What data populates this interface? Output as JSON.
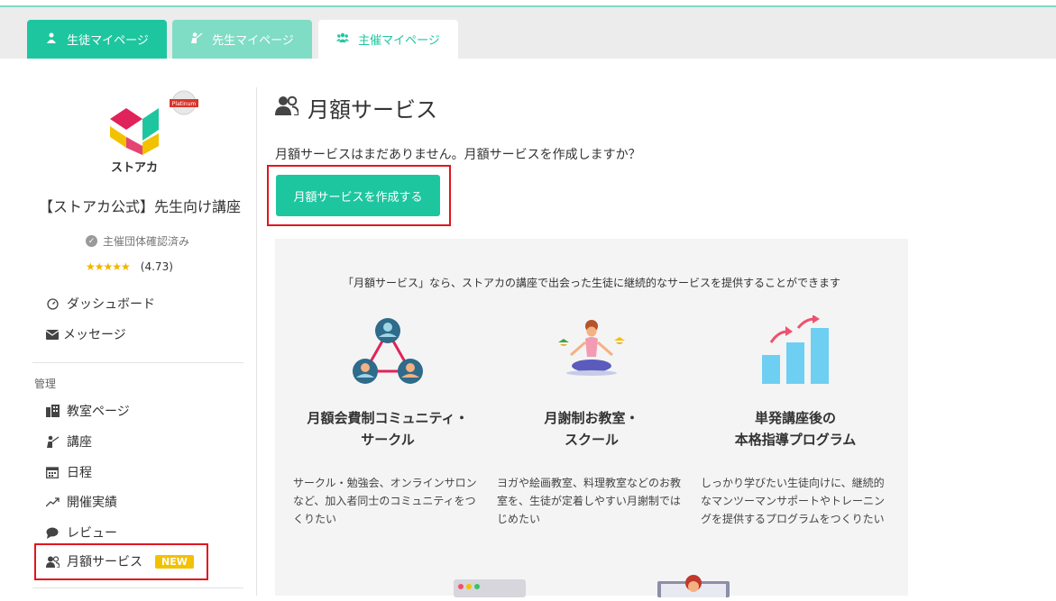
{
  "tabs": [
    {
      "label": "生徒マイページ"
    },
    {
      "label": "先生マイページ"
    },
    {
      "label": "主催マイページ"
    }
  ],
  "sidebar": {
    "logo_text": "ストアカ",
    "badge_text": "Platinum",
    "school_name": "【ストアカ公式】先生向け講座",
    "verified": "主催団体確認済み",
    "stars": "★★★★★",
    "rating": "(4.73)",
    "top_items": [
      {
        "label": "ダッシュボード"
      },
      {
        "label": "メッセージ"
      }
    ],
    "section_title": "管理",
    "manage_items": [
      {
        "label": "教室ページ"
      },
      {
        "label": "講座"
      },
      {
        "label": "日程"
      },
      {
        "label": "開催実績"
      },
      {
        "label": "レビュー"
      },
      {
        "label": "月額サービス",
        "badge": "NEW"
      }
    ]
  },
  "main": {
    "title": "月額サービス",
    "empty_message": "月額サービスはまだありません。月額サービスを作成しますか？",
    "create_button": "月額サービスを作成する",
    "info": {
      "lead": "「月額サービス」なら、ストアカの講座で出会った生徒に継続的なサービスを提供することができます",
      "features": [
        {
          "title_line1": "月額会費制コミュニティ・",
          "title_line2": "サークル",
          "desc": "サークル・勉強会、オンラインサロンなど、加入者同士のコミュニティをつくりたい"
        },
        {
          "title_line1": "月謝制お教室・",
          "title_line2": "スクール",
          "desc": "ヨガや絵画教室、料理教室などのお教室を、生徒が定着しやすい月謝制ではじめたい"
        },
        {
          "title_line1": "単発講座後の",
          "title_line2": "本格指導プログラム",
          "desc": "しっかり学びたい生徒向けに、継続的なマンツーマンサポートやトレーニングを提供するプログラムをつくりたい"
        }
      ]
    }
  },
  "colors": {
    "accent": "#1ec6a0",
    "accent_light": "#7fdcc5",
    "badge": "#f2c100",
    "highlight": "#e0161e"
  }
}
